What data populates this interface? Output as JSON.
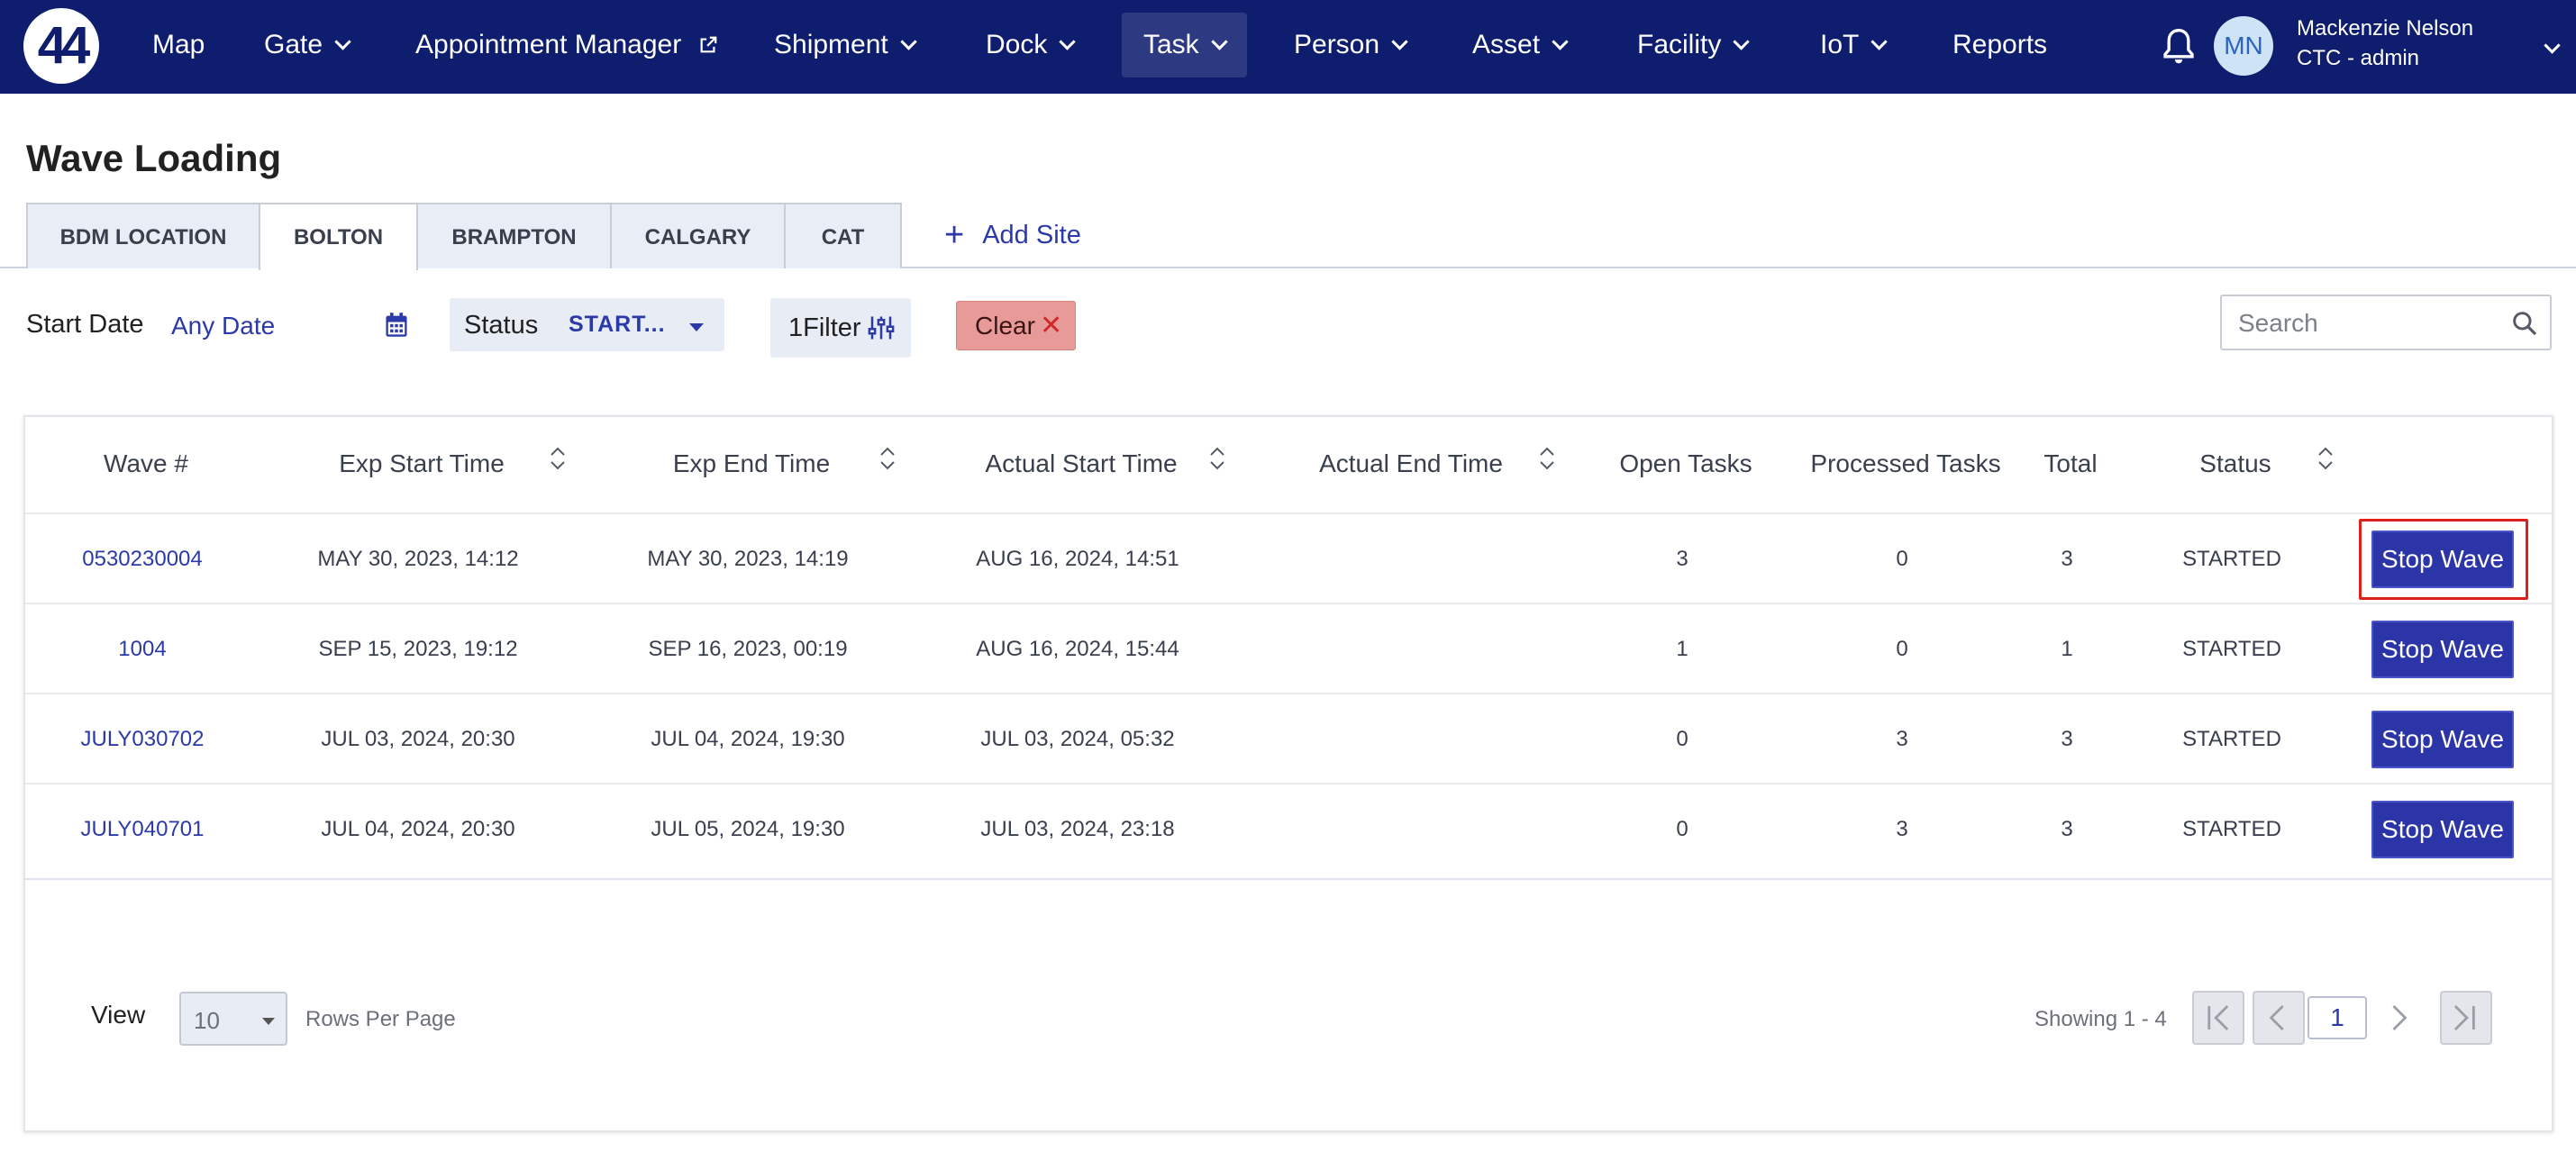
{
  "nav": {
    "logo_text": "44",
    "items": [
      {
        "label": "Map"
      },
      {
        "label": "Gate"
      },
      {
        "label": "Appointment Manager"
      },
      {
        "label": "Shipment"
      },
      {
        "label": "Dock"
      },
      {
        "label": "Task"
      },
      {
        "label": "Person"
      },
      {
        "label": "Asset"
      },
      {
        "label": "Facility"
      },
      {
        "label": "IoT"
      },
      {
        "label": "Reports"
      }
    ],
    "active_item": "Task",
    "user": {
      "initials": "MN",
      "name": "Mackenzie Nelson",
      "role": "CTC - admin"
    }
  },
  "page": {
    "title": "Wave Loading",
    "tabs": [
      {
        "label": "BDM LOCATION"
      },
      {
        "label": "BOLTON"
      },
      {
        "label": "BRAMPTON"
      },
      {
        "label": "CALGARY"
      },
      {
        "label": "CAT"
      }
    ],
    "active_tab": "BOLTON",
    "add_site_label": "Add Site"
  },
  "filters": {
    "start_date_label": "Start Date",
    "start_date_value": "Any Date",
    "status_label": "Status",
    "status_value": "START...",
    "filter_count": "1",
    "filter_label": "Filter",
    "clear_label": "Clear",
    "search_placeholder": "Search"
  },
  "table": {
    "columns": [
      {
        "label": "Wave #"
      },
      {
        "label": "Exp Start Time"
      },
      {
        "label": "Exp End Time"
      },
      {
        "label": "Actual Start Time"
      },
      {
        "label": "Actual End Time"
      },
      {
        "label": "Open Tasks"
      },
      {
        "label": "Processed Tasks"
      },
      {
        "label": "Total"
      },
      {
        "label": "Status"
      }
    ],
    "rows": [
      {
        "wave": "0530230004",
        "exp_start": "MAY 30, 2023, 14:12",
        "exp_end": "MAY 30, 2023, 14:19",
        "actual_start": "AUG 16, 2024, 14:51",
        "actual_end": "",
        "open": "3",
        "processed": "0",
        "total": "3",
        "status": "STARTED",
        "action": "Stop Wave"
      },
      {
        "wave": "1004",
        "exp_start": "SEP 15, 2023, 19:12",
        "exp_end": "SEP 16, 2023, 00:19",
        "actual_start": "AUG 16, 2024, 15:44",
        "actual_end": "",
        "open": "1",
        "processed": "0",
        "total": "1",
        "status": "STARTED",
        "action": "Stop Wave"
      },
      {
        "wave": "JULY030702",
        "exp_start": "JUL 03, 2024, 20:30",
        "exp_end": "JUL 04, 2024, 19:30",
        "actual_start": "JUL 03, 2024, 05:32",
        "actual_end": "",
        "open": "0",
        "processed": "3",
        "total": "3",
        "status": "STARTED",
        "action": "Stop Wave"
      },
      {
        "wave": "JULY040701",
        "exp_start": "JUL 04, 2024, 20:30",
        "exp_end": "JUL 05, 2024, 19:30",
        "actual_start": "JUL 03, 2024, 23:18",
        "actual_end": "",
        "open": "0",
        "processed": "3",
        "total": "3",
        "status": "STARTED",
        "action": "Stop Wave"
      }
    ]
  },
  "pagination": {
    "view_label": "View",
    "rows_per_page_value": "10",
    "rows_per_page_label": "Rows Per Page",
    "showing": "Showing 1 - 4",
    "current_page": "1"
  },
  "colors": {
    "nav_bg": "#0e1d6d",
    "accent": "#2b3aa8",
    "button": "#2b35a8",
    "clear_bg": "#e89a98",
    "highlight": "#e0201a"
  }
}
